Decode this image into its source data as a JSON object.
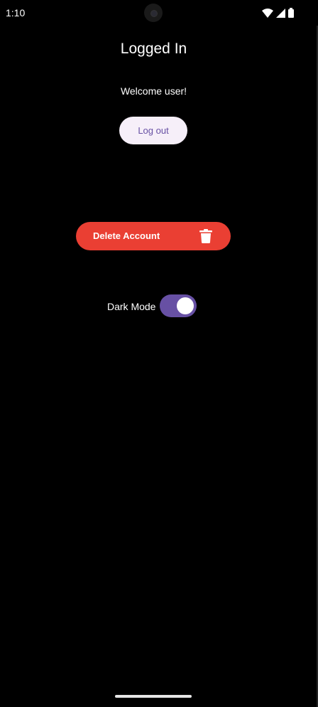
{
  "status_bar": {
    "time": "1:10",
    "icons": [
      "wifi-icon",
      "signal-icon",
      "battery-icon"
    ]
  },
  "screen": {
    "title": "Logged In",
    "welcome": "Welcome user!",
    "logout_label": "Log out",
    "delete_label": "Delete Account",
    "delete_icon": "trash-icon",
    "dark_mode_label": "Dark Mode",
    "dark_mode_enabled": true
  },
  "colors": {
    "background": "#000000",
    "logout_bg": "#f6eff9",
    "logout_text": "#6750a4",
    "delete_bg": "#ea3f33",
    "toggle_track": "#6750a4",
    "toggle_thumb": "#ffffff"
  }
}
